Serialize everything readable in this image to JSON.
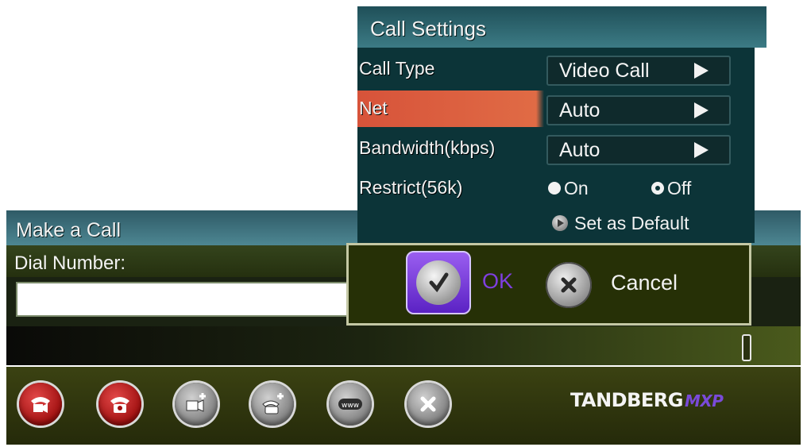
{
  "make_call": {
    "title": "Make a Call",
    "dial_label": "Dial Number:",
    "dial_value": ""
  },
  "call_settings": {
    "title": "Call Settings",
    "call_type": {
      "label": "Call Type",
      "value": "Video Call"
    },
    "net": {
      "label": "Net",
      "value": "Auto"
    },
    "bandwidth": {
      "label": "Bandwidth(kbps)",
      "value": "Auto"
    },
    "restrict": {
      "label": "Restrict(56k)",
      "options": [
        "On",
        "Off"
      ],
      "selected": "Off"
    },
    "set_default_label": "Set as Default"
  },
  "actions": {
    "ok_label": "OK",
    "cancel_label": "Cancel"
  },
  "toolbar": {
    "buttons": [
      "video-call-icon",
      "phone-call-icon",
      "add-video-icon",
      "add-phone-icon",
      "www-icon",
      "close-icon"
    ]
  },
  "brand": {
    "name": "TANDBERG",
    "model": "MXP",
    "model_color": "#7a4ad9"
  },
  "colors": {
    "highlight_row": "#d7533a",
    "dialog_bg": "#0c3438",
    "ok_button": "#7a3fe0"
  }
}
